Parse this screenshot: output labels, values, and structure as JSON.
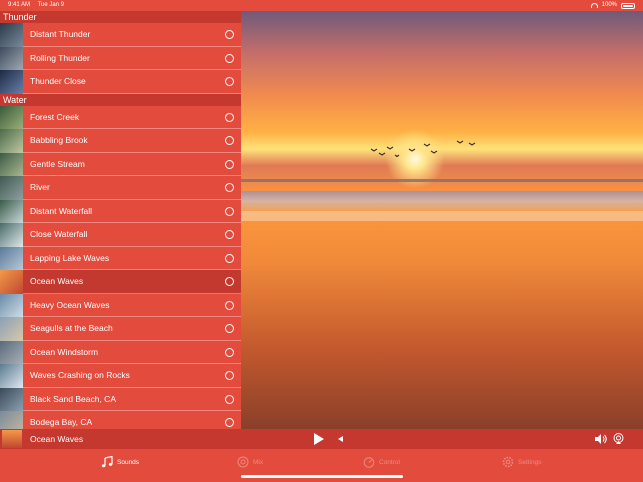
{
  "status": {
    "time": "9:41 AM",
    "date": "Tue Jan 9",
    "battery": "100%"
  },
  "sections": [
    {
      "title": "Thunder",
      "items": [
        {
          "label": "Distant Thunder",
          "thumb": [
            "#2a3a4a",
            "#7a8a9a"
          ]
        },
        {
          "label": "Rolling Thunder",
          "thumb": [
            "#3d4b5a",
            "#a0a8b5"
          ]
        },
        {
          "label": "Thunder Close",
          "thumb": [
            "#1d2a44",
            "#6a7fa8"
          ]
        }
      ]
    },
    {
      "title": "Water",
      "items": [
        {
          "label": "Forest Creek",
          "thumb": [
            "#3a5a3a",
            "#9ab07a"
          ]
        },
        {
          "label": "Babbling Brook",
          "thumb": [
            "#4a6a4a",
            "#bfc8a0"
          ]
        },
        {
          "label": "Gentle Stream",
          "thumb": [
            "#3d5a45",
            "#a8b890"
          ]
        },
        {
          "label": "River",
          "thumb": [
            "#405a50",
            "#8fa0a0"
          ]
        },
        {
          "label": "Distant Waterfall",
          "thumb": [
            "#3a5a4a",
            "#c8d8d8"
          ]
        },
        {
          "label": "Close Waterfall",
          "thumb": [
            "#4a6a6a",
            "#dfe8e8"
          ]
        },
        {
          "label": "Lapping Lake Waves",
          "thumb": [
            "#5a7a9a",
            "#b8c8d8"
          ]
        },
        {
          "label": "Ocean Waves",
          "thumb": [
            "#f39a4a",
            "#c0472f"
          ],
          "selected": true
        },
        {
          "label": "Heavy Ocean Waves",
          "thumb": [
            "#6a8aa8",
            "#d0dde8"
          ]
        },
        {
          "label": "Seagulls at the Beach",
          "thumb": [
            "#8aa0b8",
            "#d8c8a8"
          ]
        },
        {
          "label": "Ocean Windstorm",
          "thumb": [
            "#5a6a7a",
            "#a8b0b8"
          ]
        },
        {
          "label": "Waves Crashing on Rocks",
          "thumb": [
            "#5a7a90",
            "#e0e8f0"
          ]
        },
        {
          "label": "Black Sand Beach, CA",
          "thumb": [
            "#3a4a5a",
            "#8aa0b0"
          ]
        },
        {
          "label": "Bodega Bay, CA",
          "thumb": [
            "#7a8a9a",
            "#c8b8a0"
          ]
        }
      ]
    }
  ],
  "player": {
    "now_playing": "Ocean Waves"
  },
  "tabs": [
    {
      "label": "Sounds",
      "icon": "music-note-icon",
      "active": true
    },
    {
      "label": "Mix",
      "icon": "mix-icon",
      "active": false
    },
    {
      "label": "Control",
      "icon": "timer-icon",
      "active": false
    },
    {
      "label": "Settings",
      "icon": "gear-icon",
      "active": false
    }
  ]
}
